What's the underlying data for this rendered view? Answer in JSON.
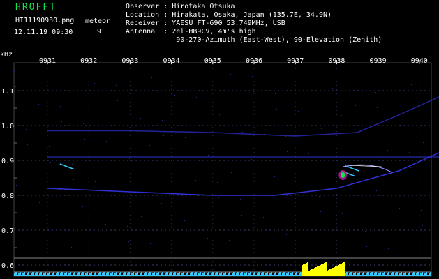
{
  "header": {
    "app_title": "HROFFT",
    "file_name": "HI11190930.png",
    "datetime": "12.11.19 09:30",
    "mode_label": "meteor",
    "count": "9"
  },
  "station": {
    "observer_label": "Observer",
    "observer": "Hirotaka Otsuka",
    "location_label": "Location",
    "location": "Hirakata, Osaka, Japan (135.7E, 34.9N)",
    "receiver_label": "Receiver",
    "receiver": "YAESU FT-690 53.749MHz, USB",
    "antenna_label": "Antenna",
    "antenna": "2el-HB9CV, 4m's high",
    "antenna_detail": "90-270-Azimuth (East-West), 90-Elevation (Zenith)"
  },
  "chart_data": {
    "type": "heatmap",
    "ylabel": "kHz",
    "x_ticks": [
      "0931",
      "0932",
      "0933",
      "0934",
      "0935",
      "0936",
      "0937",
      "0938",
      "0939",
      "0940"
    ],
    "y_ticks": [
      "1.1",
      "1.0",
      "0.9",
      "0.8",
      "0.7",
      "0.6"
    ],
    "y_tick_values": [
      1.1,
      1.0,
      0.9,
      0.8,
      0.7,
      0.6
    ],
    "ylim": [
      0.59,
      1.17
    ],
    "x_range_minutes": [
      0,
      10
    ],
    "traces": [
      {
        "points": [
          [
            0,
            0.82
          ],
          [
            2,
            0.81
          ],
          [
            4,
            0.8
          ],
          [
            5.5,
            0.8
          ],
          [
            7,
            0.82
          ],
          [
            8.5,
            0.87
          ],
          [
            10,
            0.95
          ]
        ]
      },
      {
        "points": [
          [
            0,
            0.985
          ],
          [
            2,
            0.985
          ],
          [
            4,
            0.98
          ],
          [
            6,
            0.97
          ],
          [
            7.5,
            0.98
          ],
          [
            8.5,
            1.03
          ],
          [
            10,
            1.11
          ]
        ]
      },
      {
        "points": [
          [
            0,
            0.91
          ],
          [
            3,
            0.91
          ],
          [
            6,
            0.91
          ],
          [
            10,
            0.91
          ]
        ]
      }
    ],
    "meteor_echoes": [
      {
        "t": 7.1,
        "f_start": 0.87,
        "f_end": 0.855
      },
      {
        "t": 7.2,
        "f_start": 0.885,
        "f_end": 0.87
      },
      {
        "t": 0.3,
        "f_start": 0.89,
        "f_end": 0.875
      }
    ],
    "signal_colors": {
      "trace": "#3a3aff",
      "hot": "#19e34a",
      "noise": "#35c8ff",
      "burst": "#ffff00"
    }
  }
}
